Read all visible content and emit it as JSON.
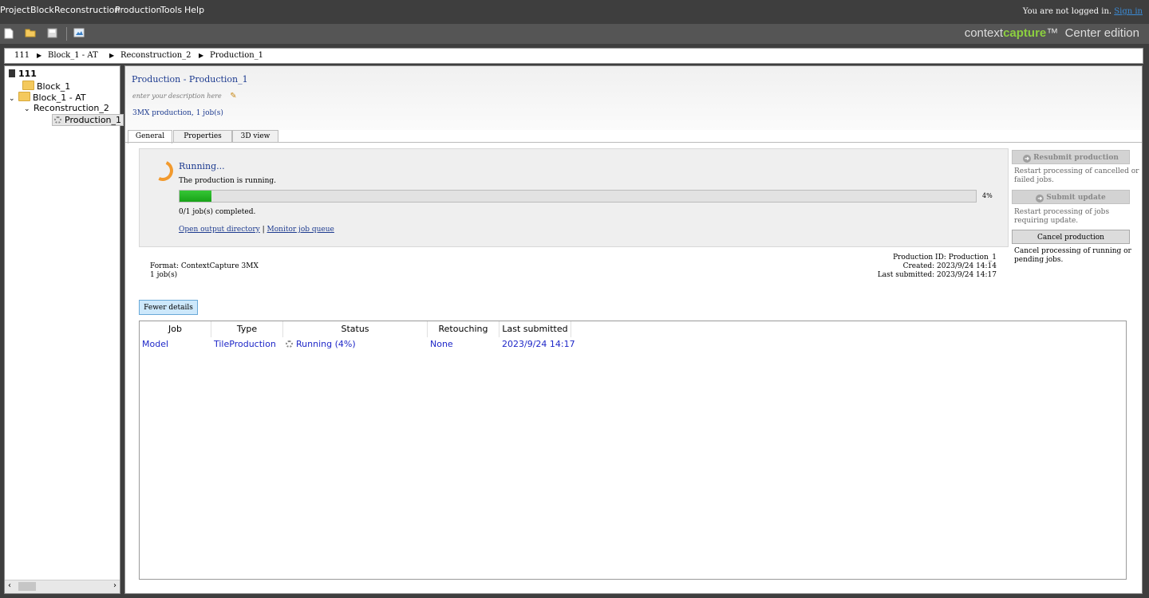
{
  "menubar": {
    "items": [
      "Project",
      "Block",
      "Reconstruction",
      "Production",
      "Tools",
      "Help"
    ],
    "login_text": "You are not logged in.",
    "signin_label": "Sign in"
  },
  "toolbar": {
    "icons": [
      "new-file-icon",
      "open-folder-icon",
      "save-icon",
      "screenshot-icon"
    ],
    "brand_prefix": "context",
    "brand_bold": "capture",
    "brand_tm": "™",
    "brand_suffix": "Center edition"
  },
  "breadcrumb": {
    "items": [
      "111",
      "Block_1 - AT",
      "Reconstruction_2",
      "Production_1"
    ]
  },
  "tree": {
    "root": "111",
    "items": [
      "Block_1",
      "Block_1 - AT",
      "Reconstruction_2",
      "Production_1"
    ]
  },
  "production": {
    "title": "Production - Production_1",
    "description_placeholder": "enter your description here",
    "summary": "3MX production, 1 job(s)"
  },
  "tabs": [
    "General",
    "Properties",
    "3D view"
  ],
  "status": {
    "title": "Running...",
    "message": "The production is running.",
    "progress": 0.04,
    "progress_label": "4%",
    "jobs_completed": "0/1 job(s) completed.",
    "link_output": "Open output directory",
    "separator": "|",
    "link_queue": "Monitor job queue"
  },
  "details": {
    "format": "Format: ContextCapture 3MX",
    "jobs": "1 job(s)",
    "production_id": "Production ID: Production_1",
    "created": "Created: 2023/9/24 14:14",
    "last_submitted": "Last submitted: 2023/9/24 14:17"
  },
  "actions": {
    "resubmit_label": "Resubmit production",
    "resubmit_desc": "Restart processing of cancelled or failed jobs.",
    "submit_update_label": "Submit update",
    "submit_update_desc": "Restart processing of jobs requiring update.",
    "cancel_label": "Cancel production",
    "cancel_desc": "Cancel processing of running or pending jobs."
  },
  "fewer_details_label": "Fewer details",
  "job_table": {
    "columns": [
      "Job",
      "Type",
      "Status",
      "Retouching",
      "Last submitted"
    ],
    "rows": [
      {
        "job": "Model",
        "type": "TileProduction",
        "status": "Running (4%)",
        "retouching": "None",
        "last_submitted": "2023/9/24 14:17"
      }
    ]
  },
  "colors": {
    "accent_blue": "#1c3a8f",
    "link_blue": "#1e27c8",
    "progress_green": "#18a318",
    "spinner_orange": "#f29a2e",
    "brand_green": "#8ccf3f"
  }
}
